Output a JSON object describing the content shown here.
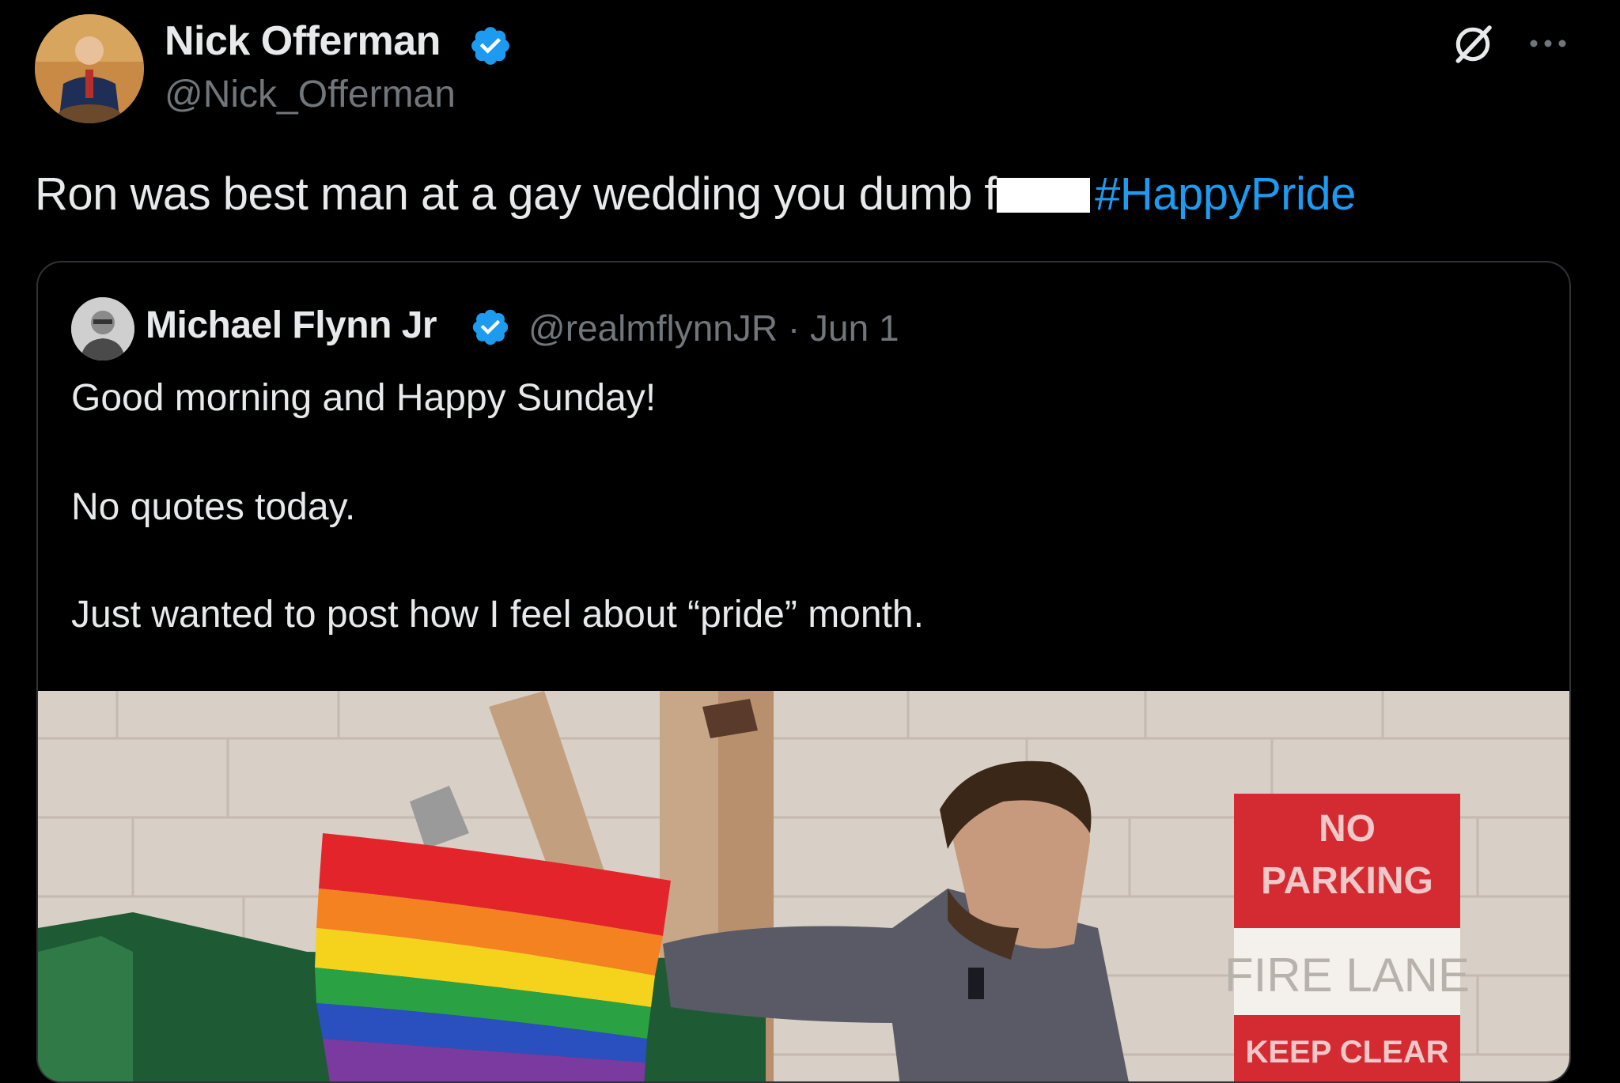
{
  "tweet": {
    "author_name": "Nick Offerman",
    "author_handle": "@Nick_Offerman",
    "text_before": "Ron was best man at a gay wedding you dumb f",
    "hashtag": "#HappyPride"
  },
  "quoted": {
    "author_name": "Michael Flynn Jr",
    "author_handle": "@realmflynnJR",
    "separator": "·",
    "date": "Jun 1",
    "lines": [
      "Good morning and Happy Sunday!",
      "No quotes today.",
      "Just wanted to post how I feel about “pride” month."
    ],
    "media": {
      "sign_lines": [
        "NO",
        "PARKING",
        "FIRE LANE",
        "KEEP CLEAR"
      ]
    }
  },
  "colors": {
    "background": "#000000",
    "text": "#e7e9ea",
    "secondary": "#71767b",
    "accent": "#1d9bf0",
    "verified": "#1d9bf0"
  },
  "icons": {
    "verified": "verified-badge-icon",
    "grok": "grok-icon",
    "more": "more-options-icon"
  }
}
